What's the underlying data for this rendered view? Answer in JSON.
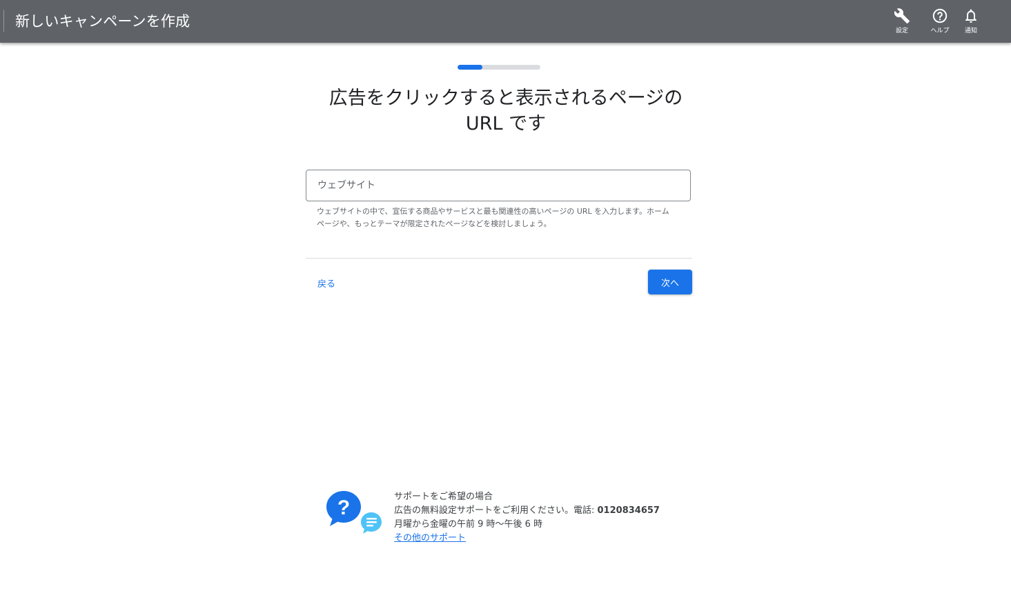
{
  "header": {
    "title": "新しいキャンペーンを作成",
    "settings_label": "設定",
    "help_label": "ヘルプ",
    "notifications_label": "通知",
    "icons": {
      "settings": "wrench-icon",
      "help": "help-circle-icon",
      "notifications": "bell-icon"
    },
    "background_color": "#5f6368"
  },
  "progress": {
    "fraction": 0.3,
    "fill_color": "#1a73e8"
  },
  "main": {
    "heading_line1": "広告をクリックすると表示されるページの",
    "heading_line2": "URL です",
    "website_field": {
      "placeholder": "ウェブサイト",
      "value": ""
    },
    "helper_text": "ウェブサイトの中で、宣伝する商品やサービスと最も関連性の高いページの URL を入力します。ホームページや、もっとテーマが限定されたページなどを検討しましょう。",
    "back_label": "戻る",
    "next_label": "次へ",
    "accent_color": "#1a73e8"
  },
  "support": {
    "line1": "サポートをご希望の場合",
    "line2_prefix": "広告の無料設定サポートをご利用ください。電話: ",
    "phone": "0120834657",
    "line3": "月曜から金曜の午前 9 時～午後 6 時",
    "more_link": "その他のサポート",
    "icons": {
      "question": "question-bubble-icon",
      "chat": "chat-bubble-icon"
    }
  }
}
